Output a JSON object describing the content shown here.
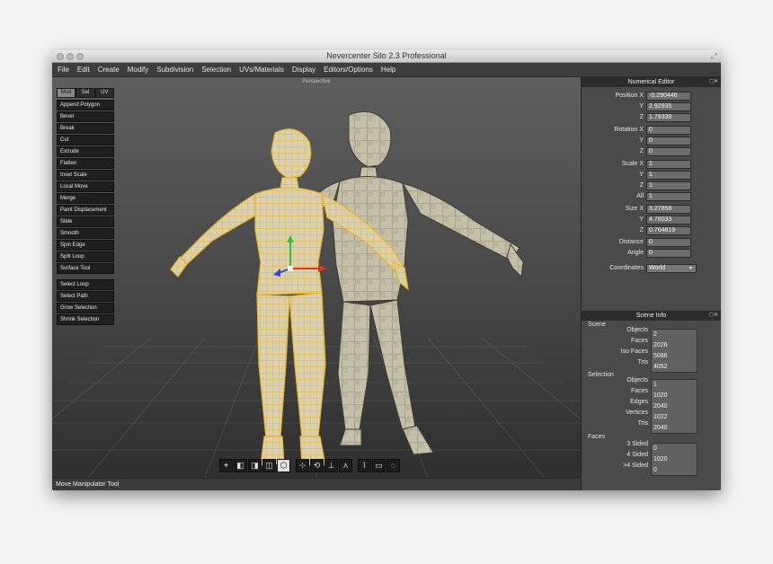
{
  "window": {
    "title": "Nevercenter Silo 2.3 Professional"
  },
  "menubar": {
    "items": [
      "File",
      "Edit",
      "Create",
      "Modify",
      "Subdivision",
      "Selection",
      "UVs/Materials",
      "Display",
      "Editors/Options",
      "Help"
    ]
  },
  "viewport": {
    "label": "Perspective"
  },
  "mode_tabs": [
    "Mod",
    "Sel",
    "UV"
  ],
  "tools": [
    "Append Polygon",
    "Bevel",
    "Break",
    "Cut",
    "Extrude",
    "Flatten",
    "Inset Scale",
    "Local Move",
    "Merge",
    "Paint Displacement",
    "Slide",
    "Smooth",
    "Spin Edge",
    "Split Loop",
    "Surface Tool"
  ],
  "selection_tools": [
    "Select Loop",
    "Select Path",
    "Grow Selection",
    "Shrink Selection"
  ],
  "bottom_toolbar": {
    "groups": [
      [
        "scale-cube-icon",
        "move-cube-icon",
        "split-cube-icon",
        "wire-cube-icon",
        "hex-icon"
      ],
      [
        "axis-move-icon",
        "axis-rotate-icon",
        "axis-scale-icon",
        "axis-universal-icon"
      ],
      [
        "lasso-select-icon",
        "rect-select-icon",
        "paint-select-icon"
      ]
    ]
  },
  "status": {
    "text": "Move Manipulator Tool"
  },
  "numerical_editor": {
    "title": "Numerical Editor",
    "position": {
      "label": "Position X",
      "x": "-0.290446",
      "y": "2.92935",
      "z": "1.79339"
    },
    "rotation": {
      "label": "Rotation X",
      "x": "0",
      "y": "0",
      "z": "0"
    },
    "scale": {
      "label": "Scale X",
      "x": "1",
      "y": "1",
      "z": "1",
      "all_label": "All",
      "all": "1"
    },
    "size": {
      "label": "Size X",
      "x": "3.27858",
      "y": "4.78033",
      "z": "0.764819"
    },
    "y_label": "Y",
    "z_label": "Z",
    "distance_label": "Distance",
    "distance": "0",
    "angle_label": "Angle",
    "angle": "0",
    "coordinates_label": "Coordinates",
    "coordinates": "World"
  },
  "scene_info": {
    "title": "Scene Info",
    "scene": {
      "label": "Scene",
      "rows": [
        [
          "Objects",
          "2"
        ],
        [
          "Faces",
          "2026"
        ],
        [
          "Iso Faces",
          "5086"
        ],
        [
          "Tris",
          "4052"
        ]
      ]
    },
    "selection": {
      "label": "Selection",
      "rows": [
        [
          "Objects",
          "1"
        ],
        [
          "Faces",
          "1020"
        ],
        [
          "Edges",
          "2040"
        ],
        [
          "Vertices",
          "1022"
        ],
        [
          "Tris",
          "2040"
        ]
      ]
    },
    "faces": {
      "label": "Faces",
      "rows": [
        [
          "3 Sided",
          "0"
        ],
        [
          "4 Sided",
          "1020"
        ],
        [
          ">4 Sided",
          "0"
        ]
      ]
    }
  },
  "colors": {
    "selected_mesh": "#f3c548",
    "background_mesh": "#cdc8b2",
    "x_axis": "#d43a2c",
    "y_axis": "#3bbf3b",
    "z_axis": "#3546d8"
  }
}
